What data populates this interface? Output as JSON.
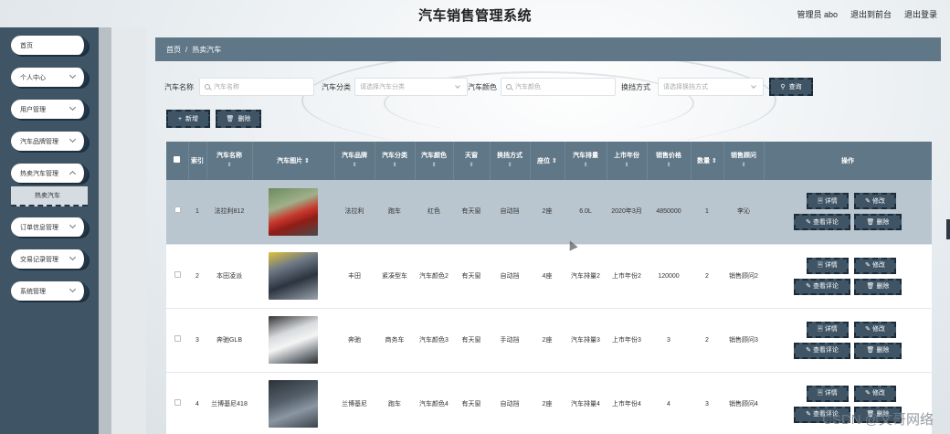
{
  "header": {
    "title": "汽车销售管理系统",
    "admin": "管理员 abo",
    "back_to_front": "退出到前台",
    "logout": "退出登录"
  },
  "sidebar": {
    "items": [
      {
        "label": "首页"
      },
      {
        "label": "个人中心"
      },
      {
        "label": "用户管理"
      },
      {
        "label": "汽车品牌管理"
      },
      {
        "label": "热卖汽车管理"
      },
      {
        "label": "订单信息管理"
      },
      {
        "label": "交易记录管理"
      },
      {
        "label": "系统管理"
      }
    ],
    "active_sub": "热卖汽车"
  },
  "breadcrumb": {
    "home": "首页",
    "sep": "/",
    "current": "热卖汽车"
  },
  "search": {
    "name_label": "汽车名称",
    "name_placeholder": "汽车名称",
    "category_label": "汽车分类",
    "category_placeholder": "请选择汽车分类",
    "color_label": "汽车颜色",
    "color_placeholder": "汽车颜色",
    "gear_label": "换挡方式",
    "gear_placeholder": "请选择换挡方式",
    "search_button": "查询"
  },
  "actions": {
    "add": "新增",
    "delete": "删除"
  },
  "table": {
    "columns": [
      "索引",
      "汽车名称",
      "汽车图片",
      "汽车品牌",
      "汽车分类",
      "汽车颜色",
      "天窗",
      "换挡方式",
      "座位",
      "汽车排量",
      "上市年份",
      "销售价格",
      "数量",
      "销售顾问",
      "操作"
    ],
    "sortable": [
      "汽车名称",
      "汽车图片",
      "汽车品牌",
      "汽车分类",
      "汽车颜色",
      "天窗",
      "换挡方式",
      "座位",
      "汽车排量",
      "上市年份",
      "销售价格",
      "数量",
      "销售顾问"
    ],
    "rows": [
      {
        "index": "1",
        "name": "法拉利812",
        "image": "car1",
        "brand": "法拉利",
        "category": "跑车",
        "color": "红色",
        "sunroof": "有天窗",
        "gear": "自动挡",
        "seats": "2座",
        "displacement": "6.0L",
        "year": "2020年3月",
        "price": "4850000",
        "qty": "1",
        "advisor": "李沁",
        "selected": true
      },
      {
        "index": "2",
        "name": "本田凌派",
        "image": "car2",
        "brand": "丰田",
        "category": "紧凑型车",
        "color": "汽车颜色2",
        "sunroof": "有天窗",
        "gear": "自动挡",
        "seats": "4座",
        "displacement": "汽车排量2",
        "year": "上市年份2",
        "price": "120000",
        "qty": "2",
        "advisor": "销售顾问2",
        "selected": false
      },
      {
        "index": "3",
        "name": "奔驰GLB",
        "image": "car3",
        "brand": "奔驰",
        "category": "商务车",
        "color": "汽车颜色3",
        "sunroof": "有天窗",
        "gear": "手动挡",
        "seats": "2座",
        "displacement": "汽车排量3",
        "year": "上市年份3",
        "price": "3",
        "qty": "2",
        "advisor": "销售顾问3",
        "selected": false
      },
      {
        "index": "4",
        "name": "兰博基尼418",
        "image": "car4",
        "brand": "兰博基尼",
        "category": "跑车",
        "color": "汽车颜色4",
        "sunroof": "有天窗",
        "gear": "自动挡",
        "seats": "2座",
        "displacement": "汽车排量4",
        "year": "上市年份4",
        "price": "4",
        "qty": "3",
        "advisor": "销售顾问4",
        "selected": false
      }
    ],
    "ops": {
      "detail": "详情",
      "edit": "修改",
      "review": "查看评论",
      "delete": "删除"
    }
  },
  "watermark": "CSDN @文哥网络"
}
